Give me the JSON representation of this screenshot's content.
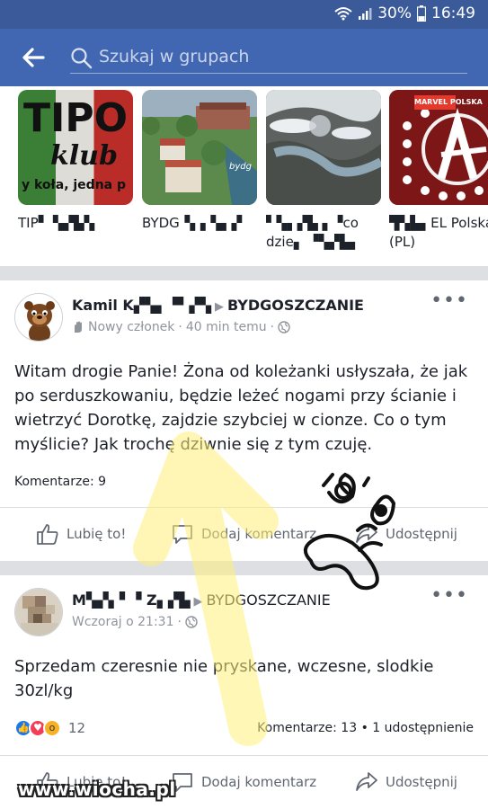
{
  "status_bar": {
    "battery": "30%",
    "time": "16:49",
    "icons": [
      "wifi-icon",
      "signal-icon",
      "battery-icon"
    ]
  },
  "header": {
    "search_placeholder": "Szukaj w grupach"
  },
  "groups": [
    {
      "name": "TIP▘ ▚▞▙▚",
      "thumb_text_1": "TIPO",
      "thumb_text_2": "klub",
      "thumb_text_3": "y koła, jedna p"
    },
    {
      "name": "BYDG▝▖▖▚▖▞",
      "thumb_text_1": "bydg"
    },
    {
      "name": "▘▚▖▞▙ ▖▝co dzie▖ ▝▚▞▙▖",
      "thumb_text_1": ""
    },
    {
      "name": "▜▚▙▖EL Polska (PL)",
      "thumb_text_1": "MARVEL POLSKA"
    }
  ],
  "posts": [
    {
      "author": "Kamil K▞▚▖▝▘▞▚",
      "group": "BYDGOSZCZANIE",
      "meta_role": "Nowy członek",
      "meta_time": "40 min temu",
      "text": "Witam drogie Panie! Żona od koleżanki usłyszała, że jak po serduszkowaniu, będzie leżeć nogami przy ścianie i wietrzyć Dorotkę, zajdzie szybciej w cionze. Co o tym myślicie? Jak trochę dziwnie się z tym czuję.",
      "comments": "Komentarze: 9",
      "like": "Lubię to!",
      "comment": "Dodaj komentarz",
      "share": "Udostępnij"
    },
    {
      "author": "M▚▞▖▘▝ Z▖▞▙",
      "group": "BYDGOSZCZANIE",
      "meta_time": "Wczoraj o 21:31",
      "text": "Sprzedam czeresnie nie pryskane, wczesne, slodkie 30zl/kg",
      "reactions_count": "12",
      "stats": "Komentarze: 13 • 1 udostępnienie",
      "like": "Lubię to!",
      "comment": "Dodaj komentarz",
      "share": "Udostępnij"
    }
  ],
  "watermark": "www.wiocha.pl",
  "colors": {
    "header": "#4267b2",
    "statusbar": "#3a5a99",
    "arrow": "#fff2a8"
  }
}
